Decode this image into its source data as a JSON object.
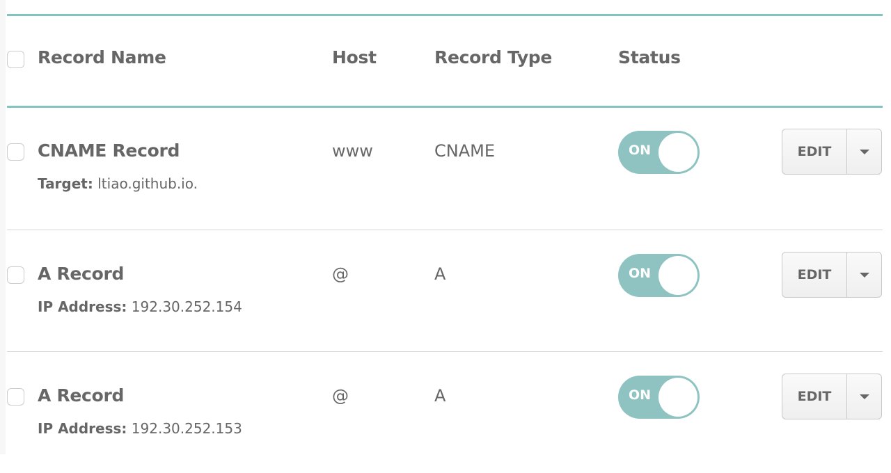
{
  "header": {
    "record_name": "Record Name",
    "host": "Host",
    "record_type": "Record Type",
    "status": "Status"
  },
  "accent_color": "#82c4c1",
  "records": [
    {
      "name": "CNAME Record",
      "detail_label": "Target:",
      "detail_value": "ltiao.github.io.",
      "host": "www",
      "type": "CNAME",
      "status": "ON",
      "edit": "EDIT"
    },
    {
      "name": "A Record",
      "detail_label": "IP Address:",
      "detail_value": "192.30.252.154",
      "host": "@",
      "type": "A",
      "status": "ON",
      "edit": "EDIT"
    },
    {
      "name": "A Record",
      "detail_label": "IP Address:",
      "detail_value": "192.30.252.153",
      "host": "@",
      "type": "A",
      "status": "ON",
      "edit": "EDIT"
    }
  ]
}
